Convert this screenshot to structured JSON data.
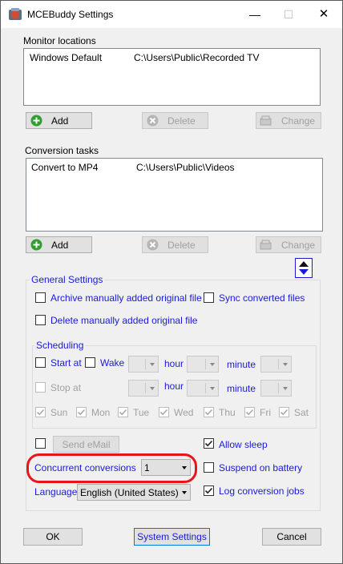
{
  "window": {
    "title": "MCEBuddy Settings",
    "min_glyph": "—",
    "max_glyph": "☐",
    "close_glyph": "✕"
  },
  "monitor": {
    "heading": "Monitor locations",
    "rows": [
      {
        "name": "Windows Default",
        "path": "C:\\Users\\Public\\Recorded TV"
      }
    ],
    "add_label": "Add",
    "delete_label": "Delete",
    "change_label": "Change"
  },
  "conversion": {
    "heading": "Conversion tasks",
    "rows": [
      {
        "name": "Convert to MP4",
        "path": "C:\\Users\\Public\\Videos"
      }
    ],
    "add_label": "Add",
    "delete_label": "Delete",
    "change_label": "Change"
  },
  "general": {
    "title": "General Settings",
    "archive_label": "Archive manually added original file",
    "sync_label": "Sync converted files",
    "delete_label": "Delete manually added original file"
  },
  "scheduling": {
    "title": "Scheduling",
    "start_label": "Start at",
    "wake_label": "Wake",
    "hour_label": "hour",
    "minute_label": "minute",
    "stop_label": "Stop at",
    "days": [
      "Sun",
      "Mon",
      "Tue",
      "Wed",
      "Thu",
      "Fri",
      "Sat"
    ]
  },
  "bottom": {
    "send_email_label": "Send eMail",
    "allow_sleep_label": "Allow sleep",
    "concurrent_label": "Concurrent conversions",
    "concurrent_value": "1",
    "suspend_label": "Suspend on battery",
    "language_label": "Language",
    "language_value": "English (United States)",
    "log_label": "Log conversion jobs"
  },
  "footer": {
    "ok_label": "OK",
    "system_label": "System Settings",
    "cancel_label": "Cancel"
  },
  "colors": {
    "accent_blue": "#1a1ad6",
    "highlight_red": "#e8141c",
    "add_green": "#2e9e2e"
  }
}
